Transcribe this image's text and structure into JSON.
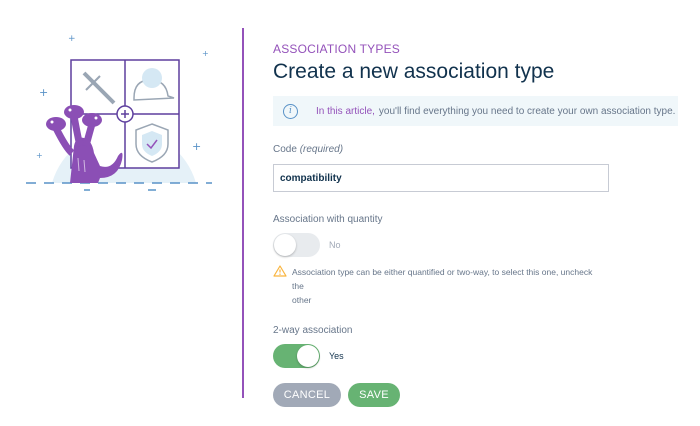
{
  "header": {
    "subtitle": "ASSOCIATION TYPES",
    "title": "Create a new association type"
  },
  "info": {
    "icon": "info-icon",
    "link_text": "In this article,",
    "text": "you'll find everything you need to create your own association type."
  },
  "code_field": {
    "label": "Code",
    "required_note": "(required)",
    "value": "compatibility"
  },
  "quantity_field": {
    "label": "Association with quantity",
    "toggle_state": "No",
    "enabled": false,
    "warning_line1": "Association type can be either quantified or two-way, to select this one, uncheck the",
    "warning_line2": "other"
  },
  "twoway_field": {
    "label": "2-way association",
    "toggle_state": "Yes",
    "enabled": true
  },
  "buttons": {
    "cancel_label": "CANCEL",
    "save_label": "SAVE"
  },
  "colors": {
    "accent": "#9452ba",
    "primary_text": "#11324d",
    "success": "#67b373",
    "neutral_button": "#a1a9b7",
    "warning": "#f9b53f"
  }
}
